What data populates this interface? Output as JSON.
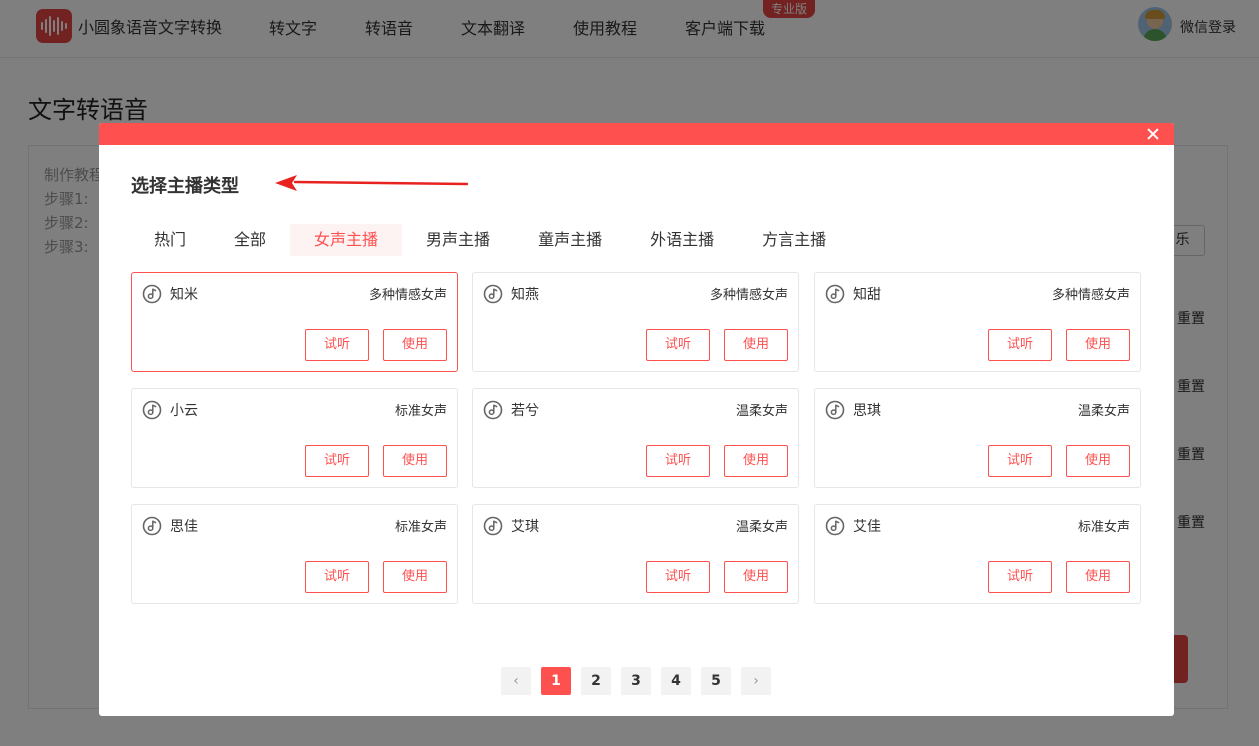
{
  "nav": {
    "brand": "小圆象语音文字转换",
    "items": [
      "转文字",
      "转语音",
      "文本翻译",
      "使用教程",
      "客户端下载"
    ],
    "pro_badge": "专业版",
    "login": "微信登录"
  },
  "page": {
    "title": "文字转语音",
    "steps": [
      "制作教程",
      "步骤1:",
      "步骤2:",
      "步骤3:"
    ],
    "right_btn": "乐",
    "reset_labels": [
      "重置",
      "重置",
      "重置",
      "重置"
    ]
  },
  "modal": {
    "title": "选择主播类型",
    "tabs": [
      "热门",
      "全部",
      "女声主播",
      "男声主播",
      "童声主播",
      "外语主播",
      "方言主播"
    ],
    "active_tab": "女声主播",
    "voices": [
      {
        "name": "知米",
        "type": "多种情感女声",
        "selected": true
      },
      {
        "name": "知燕",
        "type": "多种情感女声",
        "selected": false
      },
      {
        "name": "知甜",
        "type": "多种情感女声",
        "selected": false
      },
      {
        "name": "小云",
        "type": "标准女声",
        "selected": false
      },
      {
        "name": "若兮",
        "type": "温柔女声",
        "selected": false
      },
      {
        "name": "思琪",
        "type": "温柔女声",
        "selected": false
      },
      {
        "name": "思佳",
        "type": "标准女声",
        "selected": false
      },
      {
        "name": "艾琪",
        "type": "温柔女声",
        "selected": false
      },
      {
        "name": "艾佳",
        "type": "标准女声",
        "selected": false
      }
    ],
    "listen_label": "试听",
    "use_label": "使用",
    "pagination": {
      "prev": "‹",
      "pages": [
        "1",
        "2",
        "3",
        "4",
        "5"
      ],
      "current": "1",
      "next": "›"
    }
  },
  "colors": {
    "accent": "#ff5050",
    "brand": "#e64545"
  }
}
